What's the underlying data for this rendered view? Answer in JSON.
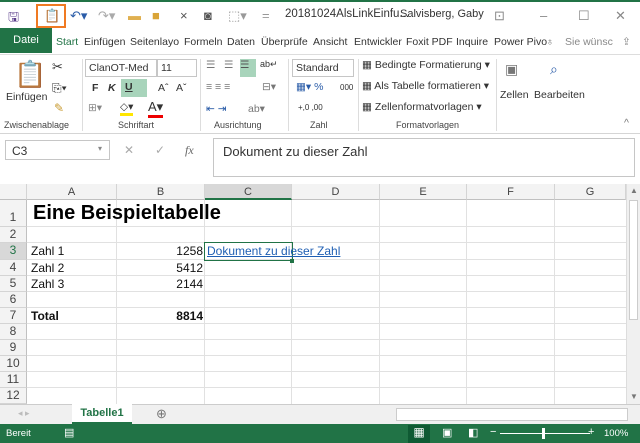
{
  "titlebar": {
    "filename": "20181024AlsLinkEinfu...",
    "user": "Salvisberg, Gaby"
  },
  "tabs": [
    "Start",
    "Einfügen",
    "Seitenlayo",
    "Formeln",
    "Daten",
    "Überprüfe",
    "Ansicht",
    "Entwickler",
    "Foxit PDF",
    "Inquire",
    "Power Pivo"
  ],
  "file_tab": "Datei",
  "tell_me": "Sie wünsc",
  "ribbon": {
    "paste": "Einfügen",
    "font_name": "ClanOT-Med",
    "font_size": "11",
    "bold": "F",
    "italic": "K",
    "underline": "U",
    "number_format": "Standard",
    "cond_format": "Bedingte Formatierung",
    "as_table": "Als Tabelle formatieren",
    "cell_styles": "Zellenformatvorlagen",
    "cells": "Zellen",
    "editing": "Bearbeiten",
    "groups": {
      "clipboard": "Zwischenablage",
      "font": "Schriftart",
      "alignment": "Ausrichtung",
      "number": "Zahl",
      "styles": "Formatvorlagen"
    }
  },
  "formula_bar": {
    "name_box": "C3",
    "fx": "fx",
    "value": "Dokument zu dieser Zahl"
  },
  "columns": [
    "A",
    "B",
    "C",
    "D",
    "E",
    "F",
    "G"
  ],
  "rows": [
    "1",
    "2",
    "3",
    "4",
    "5",
    "6",
    "7",
    "8",
    "9",
    "10",
    "11",
    "12"
  ],
  "cells": {
    "A1": "Eine Beispieltabelle",
    "A3": "Zahl 1",
    "B3": "1258",
    "C3": "Dokument zu dieser Zahl",
    "A4": "Zahl 2",
    "B4": "5412",
    "A5": "Zahl 3",
    "B5": "2144",
    "A7": "Total",
    "B7": "8814"
  },
  "sheet_tab": "Tabelle1",
  "status": {
    "text": "Bereit",
    "zoom": "100%"
  },
  "colors": {
    "accent": "#217346",
    "highlight": "#f07a22",
    "link": "#1f5fb3"
  }
}
